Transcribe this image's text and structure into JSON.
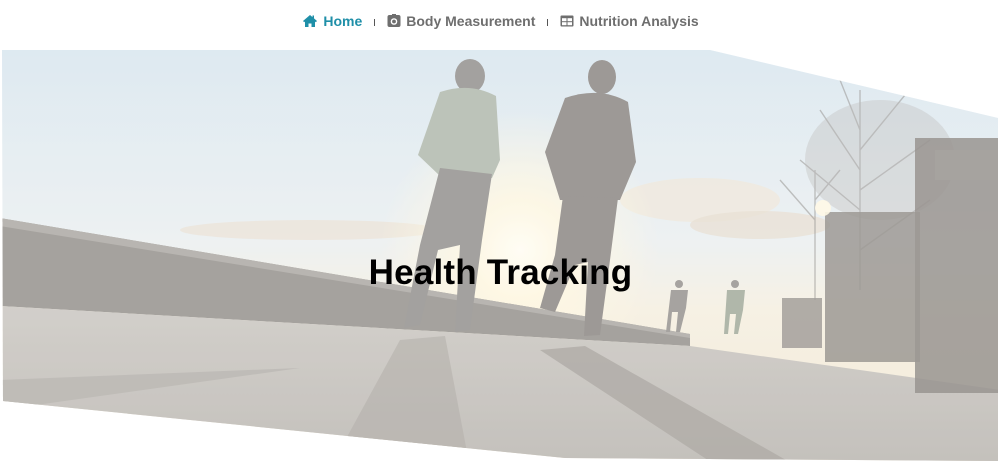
{
  "nav": {
    "items": [
      {
        "label": "Home",
        "icon": "home-icon",
        "active": true
      },
      {
        "label": "Body Measurement",
        "icon": "camera-icon",
        "active": false
      },
      {
        "label": "Nutrition Analysis",
        "icon": "table-icon",
        "active": false
      }
    ]
  },
  "hero": {
    "title": "Health Tracking"
  },
  "colors": {
    "accent": "#1f8fa8",
    "nav_text": "#6e6e6e",
    "title": "#000000"
  }
}
